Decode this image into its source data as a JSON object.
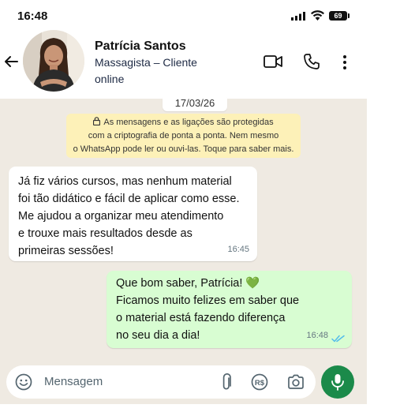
{
  "status_bar": {
    "time": "16:48",
    "battery": "69"
  },
  "contact": {
    "name": "Patrícia Santos",
    "subtitle": "Massagista – Cliente",
    "status": "online"
  },
  "chat": {
    "date": "17/03/26",
    "encryption_notice": {
      "line1": "As mensagens e as ligações são protegidas",
      "line2": "com a criptografia de ponta a ponta. Nem mesmo",
      "line3": "o WhatsApp pode ler ou ouvi-las. Toque para saber mais."
    },
    "messages": [
      {
        "direction": "incoming",
        "text": "Já fiz vários cursos, mas nenhum material\nfoi tão didático e fácil de aplicar como esse.\nMe ajudou a organizar meu atendimento\ne trouxe mais resultados desde as\nprimeiras sessões!",
        "time": "16:45"
      },
      {
        "direction": "outgoing",
        "text": "Que bom saber, Patrícia! 💚\nFicamos muito felizes em saber que\no material está fazendo diferença\nno seu dia a dia!",
        "time": "16:48",
        "read": true
      }
    ]
  },
  "input": {
    "placeholder": "Mensagem"
  },
  "icons": {
    "back": "arrow-left-icon",
    "video": "video-call-icon",
    "call": "phone-icon",
    "menu": "more-vertical-icon",
    "emoji": "emoji-icon",
    "attach": "paperclip-icon",
    "payment": "payment-icon",
    "camera": "camera-icon",
    "mic": "microphone-icon"
  },
  "colors": {
    "outgoing_bubble": "#d8fdd2",
    "incoming_bubble": "#ffffff",
    "chat_background": "#efeae2",
    "notice_background": "#fdf1b8",
    "mic_button": "#1b8a4a",
    "read_ticks": "#53bdeb"
  }
}
